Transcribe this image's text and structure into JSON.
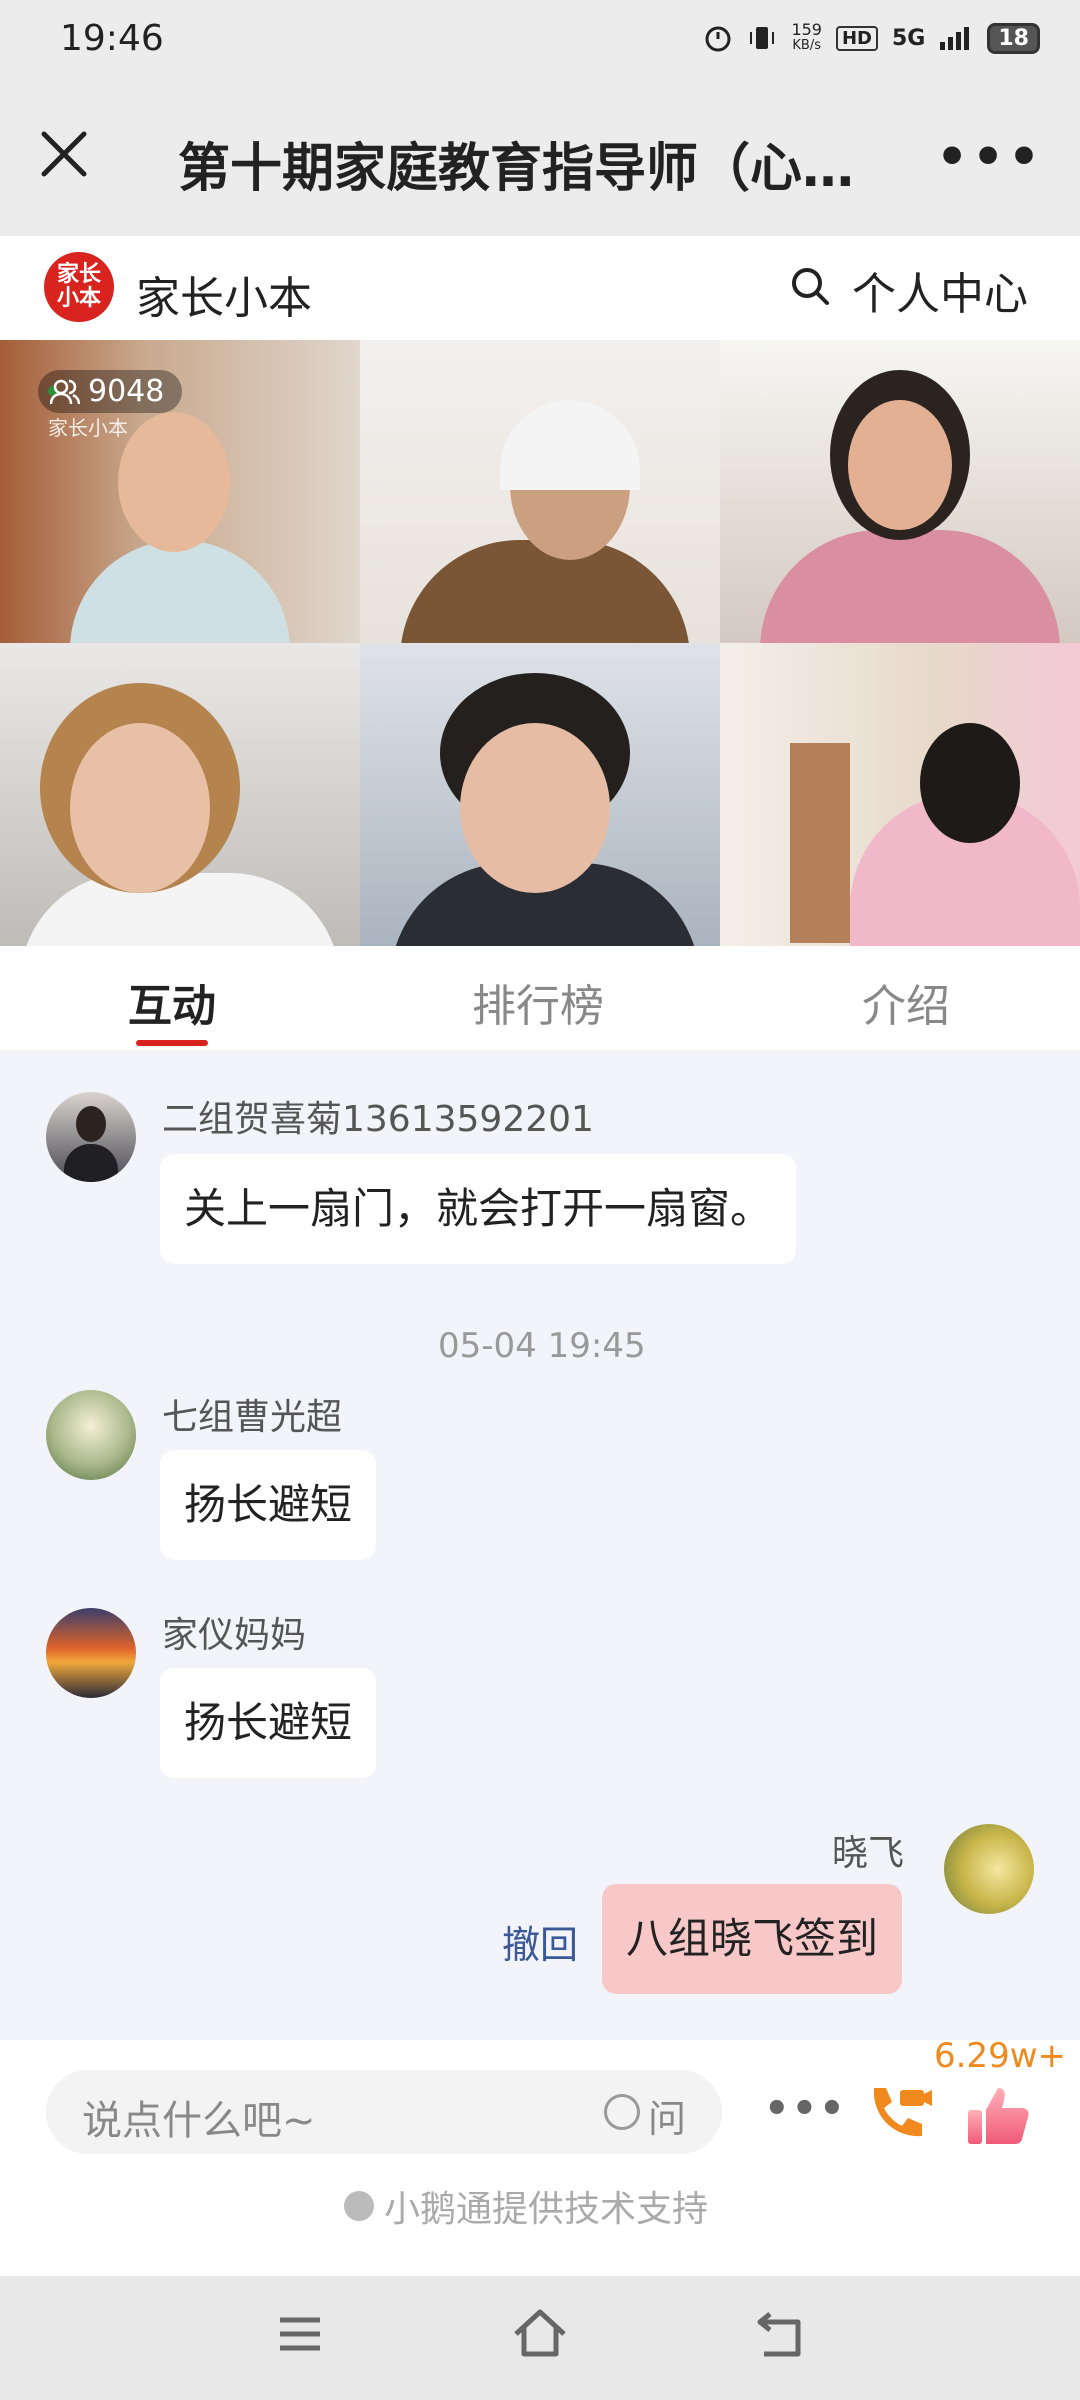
{
  "status": {
    "time": "19:46",
    "net_speed_top": "159",
    "net_speed_unit": "KB/s",
    "hd": "HD",
    "signal": "5G",
    "battery": "18"
  },
  "title_bar": {
    "title": "第十期家庭教育指导师（心…",
    "close_icon": "close-icon",
    "more_icon": "more-icon"
  },
  "brand": {
    "logo_text_line1": "家长",
    "logo_text_line2": "小本",
    "name": "家长小本",
    "personal_center": "个人中心"
  },
  "live": {
    "viewer_count": "9048",
    "watermark": "家长小本"
  },
  "tabs": [
    {
      "label": "互动",
      "active": true
    },
    {
      "label": "排行榜",
      "active": false
    },
    {
      "label": "介绍",
      "active": false
    }
  ],
  "messages": [
    {
      "user": "二组贺喜菊13613592201",
      "text": "关上一扇门，就会打开一扇窗。"
    },
    {
      "user": "七组曹光超",
      "text": "扬长避短"
    },
    {
      "user": "家仪妈妈",
      "text": "扬长避短"
    },
    {
      "user": "晓飞",
      "text": "八组晓飞签到",
      "mine": true,
      "recall_label": "撤回"
    }
  ],
  "timestamp": "05-04 19:45",
  "input": {
    "placeholder": "说点什么吧~",
    "ask_label": "问",
    "more": "•••",
    "like_count": "6.29w+"
  },
  "support_text": "小鹅通提供技术支持",
  "colors": {
    "accent": "#d8231f",
    "my_bubble": "#f8c7c7",
    "like": "#f08a1e"
  }
}
